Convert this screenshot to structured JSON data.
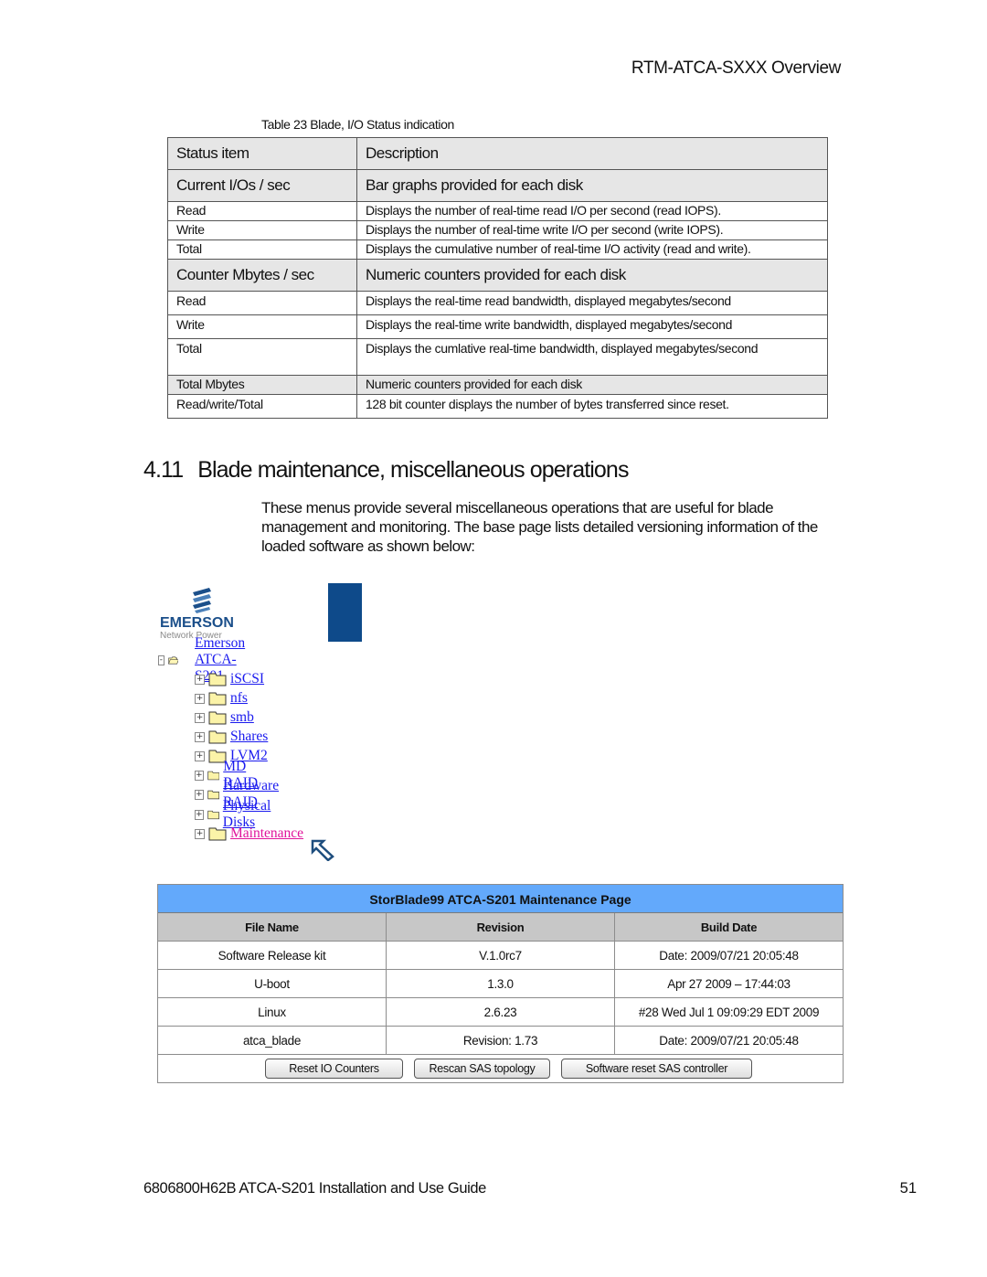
{
  "header": {
    "running_title": "RTM-ATCA-SXXX Overview"
  },
  "status_table": {
    "caption": "Table 23 Blade, I/O Status indication",
    "header": [
      "Status item",
      "Description"
    ],
    "groups": [
      {
        "item": "Current I/Os / sec",
        "description": "Bar graphs provided for each disk",
        "rows": [
          [
            "Read",
            "Displays the number of real-time read I/O per second (read IOPS)."
          ],
          [
            "Write",
            "Displays the number of real-time write I/O per second (write IOPS)."
          ],
          [
            "Total",
            "Displays the cumulative number of real-time I/O activity (read and write)."
          ]
        ]
      },
      {
        "item": "Counter Mbytes / sec",
        "description": "Numeric counters provided for each disk",
        "rows": [
          [
            "Read",
            "Displays the real-time read bandwidth, displayed megabytes/second"
          ],
          [
            "Write",
            "Displays the real-time write bandwidth, displayed megabytes/second"
          ],
          [
            "Total",
            "Displays the cumlative real-time bandwidth, displayed megabytes/second"
          ]
        ]
      },
      {
        "item": "Total Mbytes",
        "description": "Numeric counters provided for each disk",
        "rows": [
          [
            "Read/write/Total",
            "128 bit counter displays the number of bytes transferred since reset."
          ]
        ]
      }
    ]
  },
  "section": {
    "number": "4.11",
    "title": "Blade maintenance, miscellaneous operations",
    "paragraph": "These menus provide several miscellaneous operations that are useful for blade management and monitoring.  The base page lists detailed versioning information of the loaded software as shown below:"
  },
  "screenshot": {
    "logo": {
      "brand": "EMERSON",
      "tagline": "Network Power"
    },
    "tree": {
      "root": {
        "label": "Emerson ATCA-S201",
        "toggle": "-"
      },
      "children": [
        {
          "label": "iSCSI",
          "toggle": "+"
        },
        {
          "label": "nfs",
          "toggle": "+"
        },
        {
          "label": "smb",
          "toggle": "+"
        },
        {
          "label": "Shares",
          "toggle": "+"
        },
        {
          "label": "LVM2",
          "toggle": "+"
        },
        {
          "label": "MD RAID",
          "toggle": "+"
        },
        {
          "label": "Hardware RAID",
          "toggle": "+"
        },
        {
          "label": "Physical Disks",
          "toggle": "+"
        },
        {
          "label": "Maintenance",
          "toggle": "+",
          "active": true
        }
      ]
    },
    "maintenance": {
      "title": "StorBlade99 ATCA-S201 Maintenance Page",
      "columns": [
        "File Name",
        "Revision",
        "Build Date"
      ],
      "rows": [
        [
          "Software Release kit",
          "V.1.0rc7",
          "Date: 2009/07/21 20:05:48"
        ],
        [
          "U-boot",
          "1.3.0",
          "Apr 27 2009 – 17:44:03"
        ],
        [
          "Linux",
          "2.6.23",
          "#28 Wed Jul 1 09:09:29 EDT 2009"
        ],
        [
          "atca_blade",
          "Revision: 1.73",
          "Date: 2009/07/21 20:05:48"
        ]
      ],
      "buttons": [
        "Reset IO Counters",
        "Rescan SAS topology",
        "Software reset SAS controller"
      ]
    },
    "colors": {
      "title_bar": "#63a9fb",
      "header_row": "#c7c7c7",
      "link": "#1a1aee",
      "active_link": "#e0149b",
      "brand_blue": "#0e4a8a"
    }
  },
  "footer": {
    "doc_title": "6806800H62B ATCA-S201 Installation and Use Guide",
    "page_number": "51"
  }
}
